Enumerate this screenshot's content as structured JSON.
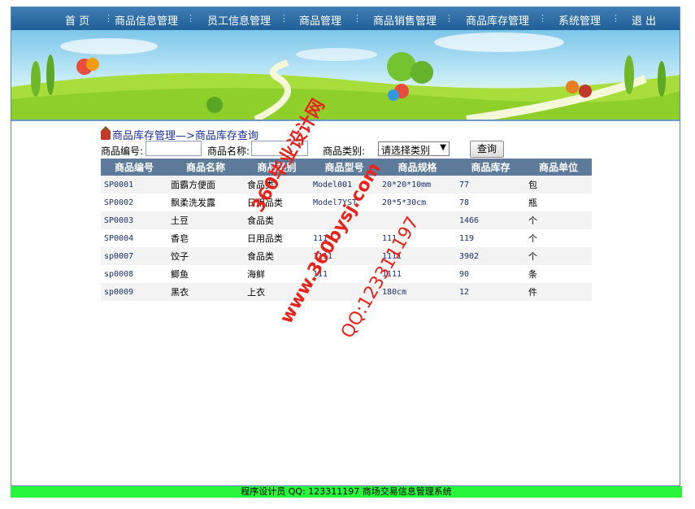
{
  "nav": {
    "items": [
      "首 页",
      "商品信息管理",
      "员工信息管理",
      "商品管理",
      "商品销售管理",
      "商品库存管理",
      "系统管理",
      "退 出"
    ]
  },
  "page": {
    "title": "商品库存管理—>商品库存查询"
  },
  "search": {
    "code_label": "商品编号:",
    "code_value": "",
    "name_label": "商品名称:",
    "name_value": "",
    "category_label": "商品类别:",
    "category_selected": "请选择类别",
    "query_button": "查询"
  },
  "table": {
    "headers": [
      "商品编号",
      "商品名称",
      "商品类别",
      "商品型号",
      "商品规格",
      "商品库存",
      "商品单位"
    ],
    "rows": [
      [
        "SP0001",
        "面霸方便面",
        "食品类",
        "Model001",
        "20*20*10mm",
        "77",
        "包"
      ],
      [
        "SP0002",
        "飘柔洗发露",
        "日用品类",
        "Model7YST",
        "20*5*30cm",
        "78",
        "瓶"
      ],
      [
        "SP0003",
        "土豆",
        "食品类",
        "",
        "",
        "1466",
        "个"
      ],
      [
        "SP0004",
        "香皂",
        "日用品类",
        "111",
        "111",
        "119",
        "个"
      ],
      [
        "sp0007",
        "饺子",
        "食品类",
        "1111",
        "1111",
        "3902",
        "个"
      ],
      [
        "sp0008",
        "鲫鱼",
        "海鲜",
        "111",
        "1111",
        "90",
        "条"
      ],
      [
        "sp0009",
        "黑衣",
        "上衣",
        "",
        "180cm",
        "12",
        "件"
      ]
    ]
  },
  "watermark": {
    "line1": "360毕业设计网",
    "line2": "www.360bysj.com",
    "line3": "QQ:123311197"
  },
  "footer": {
    "text": "程序设计员 QQ: 123311197 商场交易信息管理系统"
  },
  "colors": {
    "nav_bg": "#2a6aa4",
    "table_header_bg": "#5e7a9b",
    "footer_bg": "#29f53c",
    "watermark": "#e8231b"
  }
}
